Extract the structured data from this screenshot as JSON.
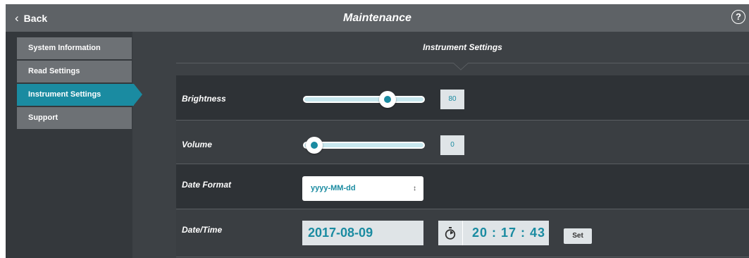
{
  "header": {
    "back_label": "Back",
    "title": "Maintenance",
    "help_label": "?"
  },
  "sidebar": {
    "items": [
      {
        "label": "System Information",
        "active": false
      },
      {
        "label": "Read Settings",
        "active": false
      },
      {
        "label": "Instrument Settings",
        "active": true
      },
      {
        "label": "Support",
        "active": false
      }
    ]
  },
  "section": {
    "title": "Instrument Settings"
  },
  "settings": {
    "brightness": {
      "label": "Brightness",
      "value": "80",
      "level": 0.8
    },
    "volume": {
      "label": "Volume",
      "value": "0",
      "level": 0.0
    },
    "date_format": {
      "label": "Date Format",
      "selected": "yyyy-MM-dd"
    },
    "date_time": {
      "label": "Date/Time",
      "date": "2017-08-09",
      "time": "20 : 17 : 43",
      "set_label": "Set"
    }
  },
  "colors": {
    "accent": "#1a8ba1",
    "header_bg": "#5e6266",
    "panel_bg": "#3d4145"
  },
  "icons": {
    "back": "chevron-left-icon",
    "help": "question-circle-icon",
    "select": "updown-arrows-icon",
    "time": "stopwatch-icon"
  }
}
